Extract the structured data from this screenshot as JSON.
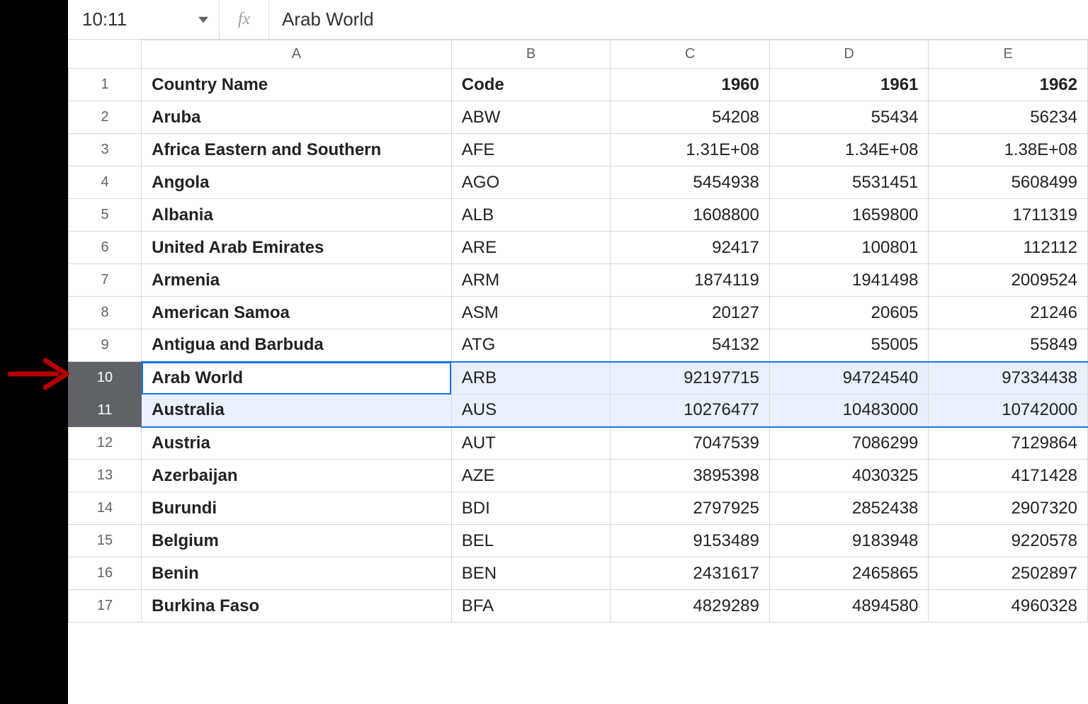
{
  "formula_bar": {
    "namebox": "10:11",
    "fx_label": "fx",
    "formula_value": "Arab World"
  },
  "columns": [
    "A",
    "B",
    "C",
    "D",
    "E"
  ],
  "selection": {
    "active_cell": "A10",
    "rows": [
      10,
      11
    ]
  },
  "headers": {
    "country": "Country Name",
    "code": "Code",
    "y1960": "1960",
    "y1961": "1961",
    "y1962": "1962"
  },
  "rows": [
    {
      "n": 2,
      "country": "Aruba",
      "code": "ABW",
      "v": [
        "54208",
        "55434",
        "56234"
      ]
    },
    {
      "n": 3,
      "country": "Africa Eastern and Southern",
      "code": "AFE",
      "v": [
        "1.31E+08",
        "1.34E+08",
        "1.38E+08"
      ]
    },
    {
      "n": 4,
      "country": "Angola",
      "code": "AGO",
      "v": [
        "5454938",
        "5531451",
        "5608499"
      ]
    },
    {
      "n": 5,
      "country": "Albania",
      "code": "ALB",
      "v": [
        "1608800",
        "1659800",
        "1711319"
      ]
    },
    {
      "n": 6,
      "country": "United Arab Emirates",
      "code": "ARE",
      "v": [
        "92417",
        "100801",
        "112112"
      ]
    },
    {
      "n": 7,
      "country": "Armenia",
      "code": "ARM",
      "v": [
        "1874119",
        "1941498",
        "2009524"
      ]
    },
    {
      "n": 8,
      "country": "American Samoa",
      "code": "ASM",
      "v": [
        "20127",
        "20605",
        "21246"
      ]
    },
    {
      "n": 9,
      "country": "Antigua and Barbuda",
      "code": "ATG",
      "v": [
        "54132",
        "55005",
        "55849"
      ]
    },
    {
      "n": 10,
      "country": "Arab World",
      "code": "ARB",
      "v": [
        "92197715",
        "94724540",
        "97334438"
      ]
    },
    {
      "n": 11,
      "country": "Australia",
      "code": "AUS",
      "v": [
        "10276477",
        "10483000",
        "10742000"
      ]
    },
    {
      "n": 12,
      "country": "Austria",
      "code": "AUT",
      "v": [
        "7047539",
        "7086299",
        "7129864"
      ]
    },
    {
      "n": 13,
      "country": "Azerbaijan",
      "code": "AZE",
      "v": [
        "3895398",
        "4030325",
        "4171428"
      ]
    },
    {
      "n": 14,
      "country": "Burundi",
      "code": "BDI",
      "v": [
        "2797925",
        "2852438",
        "2907320"
      ]
    },
    {
      "n": 15,
      "country": "Belgium",
      "code": "BEL",
      "v": [
        "9153489",
        "9183948",
        "9220578"
      ]
    },
    {
      "n": 16,
      "country": "Benin",
      "code": "BEN",
      "v": [
        "2431617",
        "2465865",
        "2502897"
      ]
    },
    {
      "n": 17,
      "country": "Burkina Faso",
      "code": "BFA",
      "v": [
        "4829289",
        "4894580",
        "4960328"
      ]
    }
  ]
}
